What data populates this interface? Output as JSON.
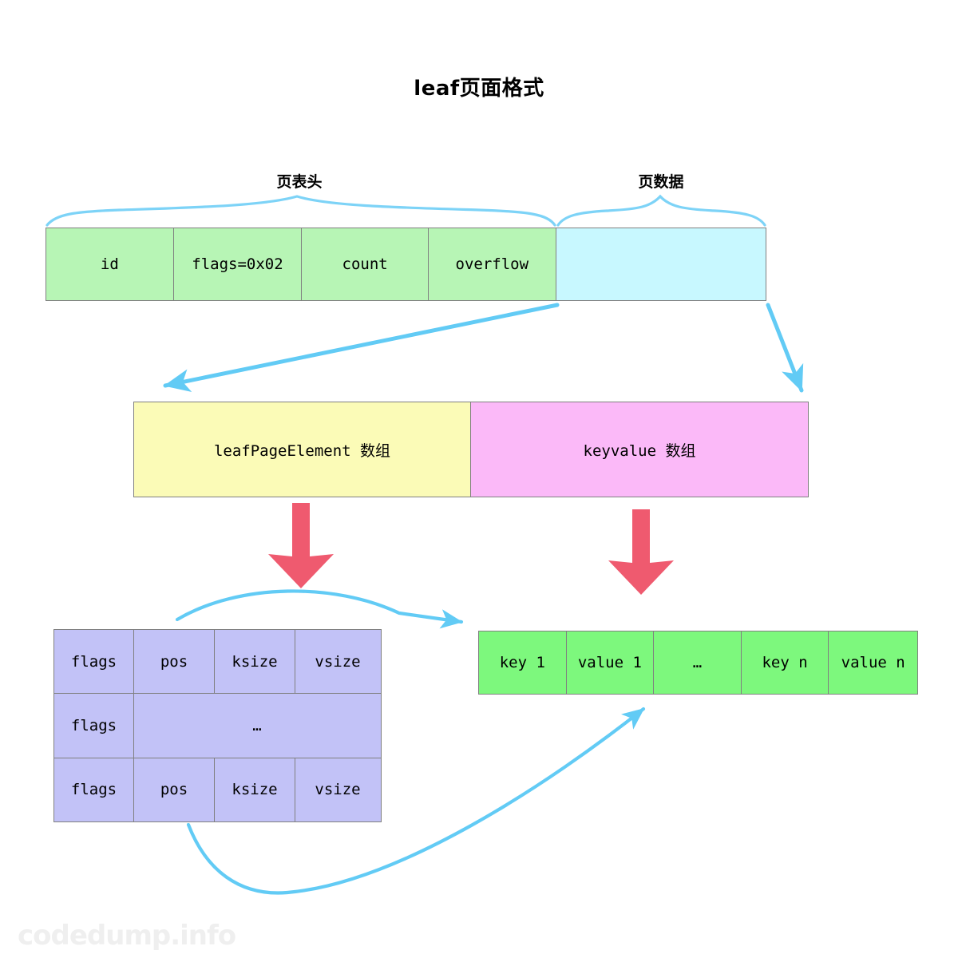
{
  "title": "leaf页面格式",
  "braces": {
    "header_label": "页表头",
    "data_label": "页数据"
  },
  "page_row": {
    "cells": [
      {
        "text": "id",
        "kind": "header"
      },
      {
        "text": "flags=0x02",
        "kind": "header"
      },
      {
        "text": "count",
        "kind": "header"
      },
      {
        "text": "overflow",
        "kind": "header"
      },
      {
        "text": "",
        "kind": "data"
      }
    ]
  },
  "split_row": {
    "left_label": "leafPageElement 数组",
    "right_label": "keyvalue 数组"
  },
  "element_table": {
    "rows": [
      {
        "cells": [
          "flags",
          "pos",
          "ksize",
          "vsize"
        ]
      },
      {
        "cells": [
          "flags",
          "…"
        ]
      },
      {
        "cells": [
          "flags",
          "pos",
          "ksize",
          "vsize"
        ]
      }
    ]
  },
  "kv_row": {
    "cells": [
      "key 1",
      "value 1",
      "…",
      "key n",
      "value n"
    ]
  },
  "colors": {
    "page_header": "#b7f5b5",
    "page_data": "#c8f8ff",
    "element_array": "#fbfbb7",
    "keyvalue_array": "#fbb9f8",
    "element_table": "#c2c2f7",
    "kv_cells": "#7df87d",
    "arrow_blue": "#62cbf5",
    "arrow_red": "#ef5a6f",
    "border": "#808080"
  },
  "watermark": "codedump.info"
}
